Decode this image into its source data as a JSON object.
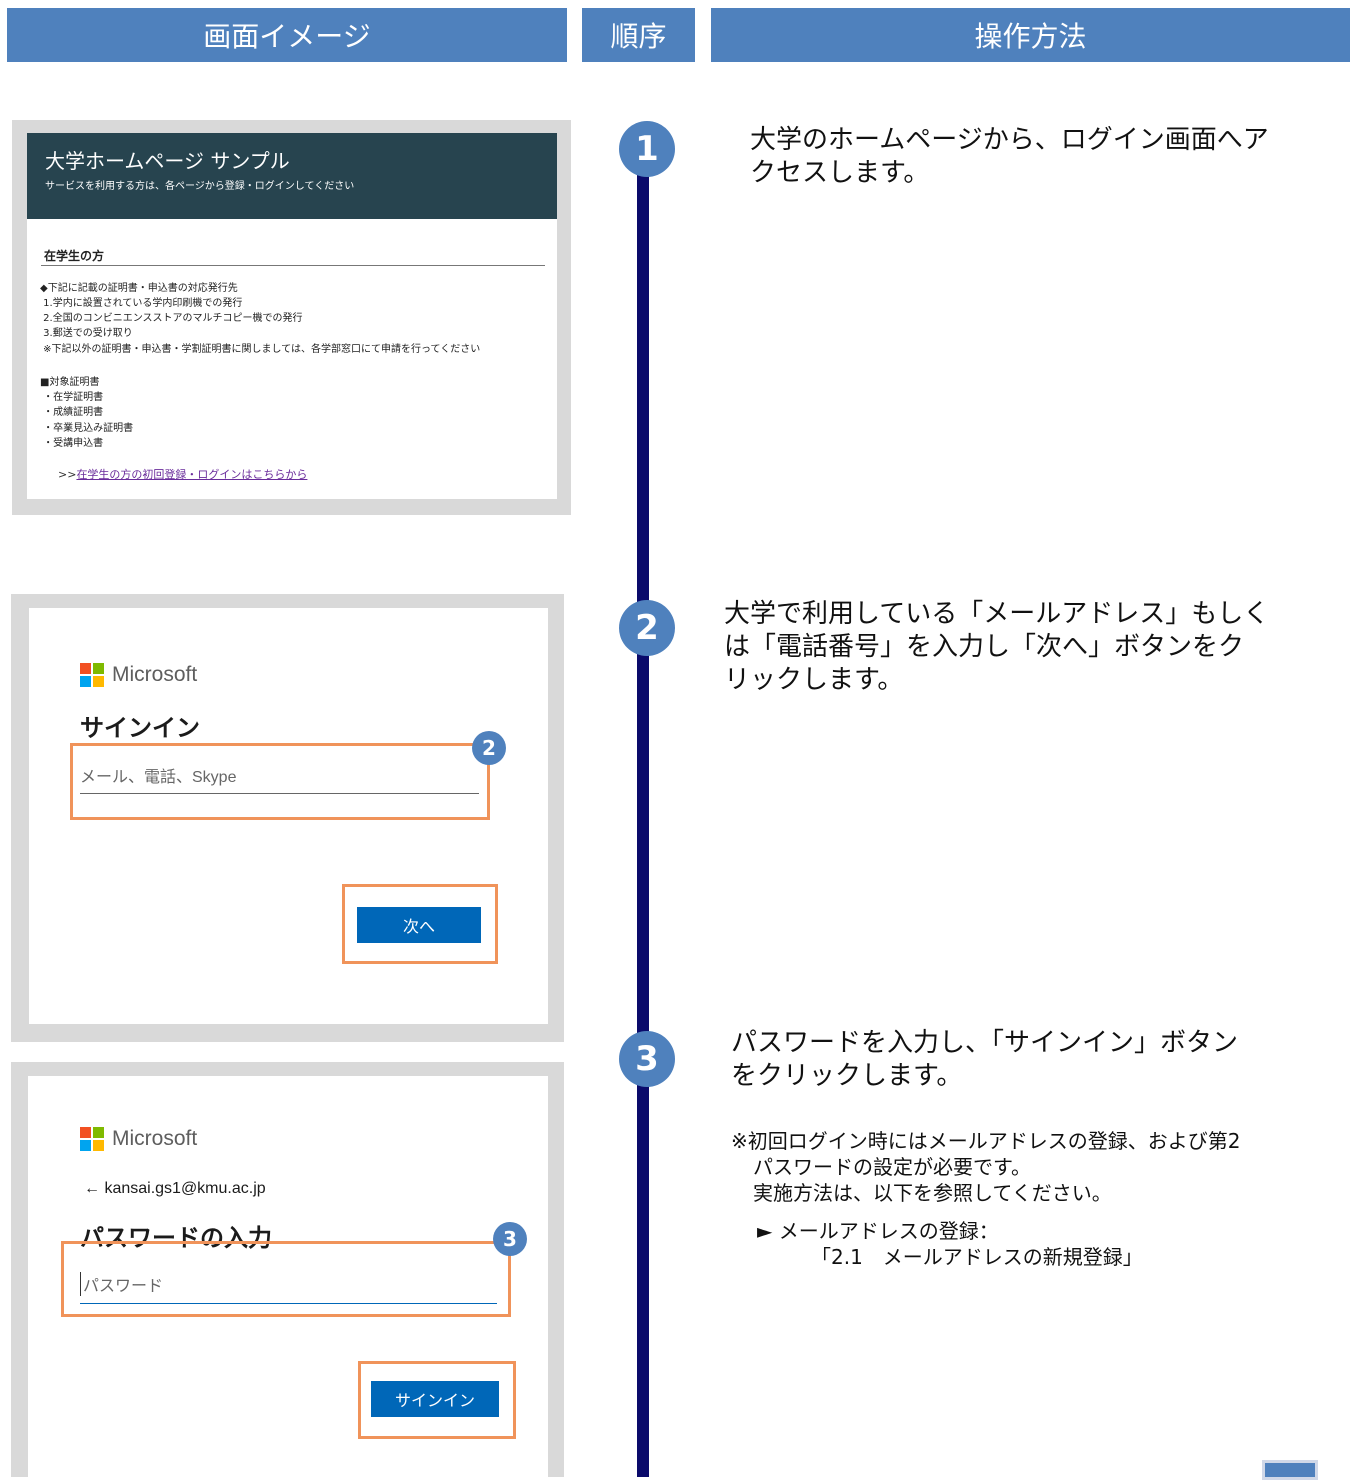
{
  "header": {
    "col1": "画面イメージ",
    "col2": "順序",
    "col3": "操作方法"
  },
  "steps": [
    {
      "num": "1",
      "text_lines": [
        "大学のホームページから、ログイン画面へア",
        "クセスします。"
      ]
    },
    {
      "num": "2",
      "text_lines": [
        "大学で利用している「メールアドレス」もしく",
        "は「電話番号」を入力し「次へ」ボタンをク",
        "リックします。"
      ]
    },
    {
      "num": "3",
      "text_lines": [
        "パスワードを入力し、「サインイン」ボタン",
        "をクリックします。"
      ]
    }
  ],
  "note": {
    "lines": [
      "※初回ログイン時にはメールアドレスの登録、および第2",
      "パスワードの設定が必要です。",
      "実施方法は、以下を参照してください。"
    ],
    "bullet": "► メールアドレスの登録：",
    "ref": "「2.1　メールアドレスの新規登録」"
  },
  "uni_page": {
    "title": "大学ホームページ サンプル",
    "subtitle": "サービスを利用する方は、各ページから登録・ログインしてください",
    "section": "在学生の方",
    "lines": [
      "◆下記に記載の証明書・申込書の対応発行先",
      " 1.学内に設置されている学内印刷機での発行",
      " 2.全国のコンビニエンスストアのマルチコピー機での発行",
      " 3.郵送での受け取り",
      " ※下記以外の証明書・申込書・学割証明書に関しましては、各学部窓口にて申請を行ってください",
      "",
      "■対象証明書",
      " ・在学証明書",
      " ・成績証明書",
      " ・卒業見込み証明書",
      " ・受講申込書"
    ],
    "link_prefix": ">>",
    "link_text": "在学生の方の初回登録・ログインはこちらから"
  },
  "signin": {
    "brand": "Microsoft",
    "title": "サインイン",
    "placeholder": "メール、電話、Skype",
    "next_button": "次へ",
    "badge": "2"
  },
  "password": {
    "brand": "Microsoft",
    "account": "← kansai.gs1@kmu.ac.jp",
    "title": "パスワードの入力",
    "placeholder": "パスワード",
    "signin_button": "サインイン",
    "badge": "3"
  }
}
